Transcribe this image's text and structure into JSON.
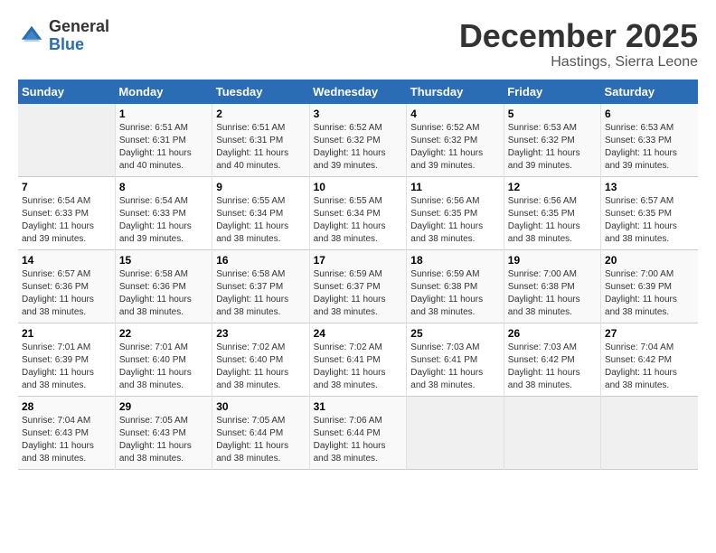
{
  "logo": {
    "general": "General",
    "blue": "Blue"
  },
  "title": "December 2025",
  "location": "Hastings, Sierra Leone",
  "weekdays": [
    "Sunday",
    "Monday",
    "Tuesday",
    "Wednesday",
    "Thursday",
    "Friday",
    "Saturday"
  ],
  "weeks": [
    [
      {
        "day": "",
        "sunrise": "",
        "sunset": "",
        "daylight": ""
      },
      {
        "day": "1",
        "sunrise": "Sunrise: 6:51 AM",
        "sunset": "Sunset: 6:31 PM",
        "daylight": "Daylight: 11 hours and 40 minutes."
      },
      {
        "day": "2",
        "sunrise": "Sunrise: 6:51 AM",
        "sunset": "Sunset: 6:31 PM",
        "daylight": "Daylight: 11 hours and 40 minutes."
      },
      {
        "day": "3",
        "sunrise": "Sunrise: 6:52 AM",
        "sunset": "Sunset: 6:32 PM",
        "daylight": "Daylight: 11 hours and 39 minutes."
      },
      {
        "day": "4",
        "sunrise": "Sunrise: 6:52 AM",
        "sunset": "Sunset: 6:32 PM",
        "daylight": "Daylight: 11 hours and 39 minutes."
      },
      {
        "day": "5",
        "sunrise": "Sunrise: 6:53 AM",
        "sunset": "Sunset: 6:32 PM",
        "daylight": "Daylight: 11 hours and 39 minutes."
      },
      {
        "day": "6",
        "sunrise": "Sunrise: 6:53 AM",
        "sunset": "Sunset: 6:33 PM",
        "daylight": "Daylight: 11 hours and 39 minutes."
      }
    ],
    [
      {
        "day": "7",
        "sunrise": "Sunrise: 6:54 AM",
        "sunset": "Sunset: 6:33 PM",
        "daylight": "Daylight: 11 hours and 39 minutes."
      },
      {
        "day": "8",
        "sunrise": "Sunrise: 6:54 AM",
        "sunset": "Sunset: 6:33 PM",
        "daylight": "Daylight: 11 hours and 39 minutes."
      },
      {
        "day": "9",
        "sunrise": "Sunrise: 6:55 AM",
        "sunset": "Sunset: 6:34 PM",
        "daylight": "Daylight: 11 hours and 38 minutes."
      },
      {
        "day": "10",
        "sunrise": "Sunrise: 6:55 AM",
        "sunset": "Sunset: 6:34 PM",
        "daylight": "Daylight: 11 hours and 38 minutes."
      },
      {
        "day": "11",
        "sunrise": "Sunrise: 6:56 AM",
        "sunset": "Sunset: 6:35 PM",
        "daylight": "Daylight: 11 hours and 38 minutes."
      },
      {
        "day": "12",
        "sunrise": "Sunrise: 6:56 AM",
        "sunset": "Sunset: 6:35 PM",
        "daylight": "Daylight: 11 hours and 38 minutes."
      },
      {
        "day": "13",
        "sunrise": "Sunrise: 6:57 AM",
        "sunset": "Sunset: 6:35 PM",
        "daylight": "Daylight: 11 hours and 38 minutes."
      }
    ],
    [
      {
        "day": "14",
        "sunrise": "Sunrise: 6:57 AM",
        "sunset": "Sunset: 6:36 PM",
        "daylight": "Daylight: 11 hours and 38 minutes."
      },
      {
        "day": "15",
        "sunrise": "Sunrise: 6:58 AM",
        "sunset": "Sunset: 6:36 PM",
        "daylight": "Daylight: 11 hours and 38 minutes."
      },
      {
        "day": "16",
        "sunrise": "Sunrise: 6:58 AM",
        "sunset": "Sunset: 6:37 PM",
        "daylight": "Daylight: 11 hours and 38 minutes."
      },
      {
        "day": "17",
        "sunrise": "Sunrise: 6:59 AM",
        "sunset": "Sunset: 6:37 PM",
        "daylight": "Daylight: 11 hours and 38 minutes."
      },
      {
        "day": "18",
        "sunrise": "Sunrise: 6:59 AM",
        "sunset": "Sunset: 6:38 PM",
        "daylight": "Daylight: 11 hours and 38 minutes."
      },
      {
        "day": "19",
        "sunrise": "Sunrise: 7:00 AM",
        "sunset": "Sunset: 6:38 PM",
        "daylight": "Daylight: 11 hours and 38 minutes."
      },
      {
        "day": "20",
        "sunrise": "Sunrise: 7:00 AM",
        "sunset": "Sunset: 6:39 PM",
        "daylight": "Daylight: 11 hours and 38 minutes."
      }
    ],
    [
      {
        "day": "21",
        "sunrise": "Sunrise: 7:01 AM",
        "sunset": "Sunset: 6:39 PM",
        "daylight": "Daylight: 11 hours and 38 minutes."
      },
      {
        "day": "22",
        "sunrise": "Sunrise: 7:01 AM",
        "sunset": "Sunset: 6:40 PM",
        "daylight": "Daylight: 11 hours and 38 minutes."
      },
      {
        "day": "23",
        "sunrise": "Sunrise: 7:02 AM",
        "sunset": "Sunset: 6:40 PM",
        "daylight": "Daylight: 11 hours and 38 minutes."
      },
      {
        "day": "24",
        "sunrise": "Sunrise: 7:02 AM",
        "sunset": "Sunset: 6:41 PM",
        "daylight": "Daylight: 11 hours and 38 minutes."
      },
      {
        "day": "25",
        "sunrise": "Sunrise: 7:03 AM",
        "sunset": "Sunset: 6:41 PM",
        "daylight": "Daylight: 11 hours and 38 minutes."
      },
      {
        "day": "26",
        "sunrise": "Sunrise: 7:03 AM",
        "sunset": "Sunset: 6:42 PM",
        "daylight": "Daylight: 11 hours and 38 minutes."
      },
      {
        "day": "27",
        "sunrise": "Sunrise: 7:04 AM",
        "sunset": "Sunset: 6:42 PM",
        "daylight": "Daylight: 11 hours and 38 minutes."
      }
    ],
    [
      {
        "day": "28",
        "sunrise": "Sunrise: 7:04 AM",
        "sunset": "Sunset: 6:43 PM",
        "daylight": "Daylight: 11 hours and 38 minutes."
      },
      {
        "day": "29",
        "sunrise": "Sunrise: 7:05 AM",
        "sunset": "Sunset: 6:43 PM",
        "daylight": "Daylight: 11 hours and 38 minutes."
      },
      {
        "day": "30",
        "sunrise": "Sunrise: 7:05 AM",
        "sunset": "Sunset: 6:44 PM",
        "daylight": "Daylight: 11 hours and 38 minutes."
      },
      {
        "day": "31",
        "sunrise": "Sunrise: 7:06 AM",
        "sunset": "Sunset: 6:44 PM",
        "daylight": "Daylight: 11 hours and 38 minutes."
      },
      {
        "day": "",
        "sunrise": "",
        "sunset": "",
        "daylight": ""
      },
      {
        "day": "",
        "sunrise": "",
        "sunset": "",
        "daylight": ""
      },
      {
        "day": "",
        "sunrise": "",
        "sunset": "",
        "daylight": ""
      }
    ]
  ]
}
